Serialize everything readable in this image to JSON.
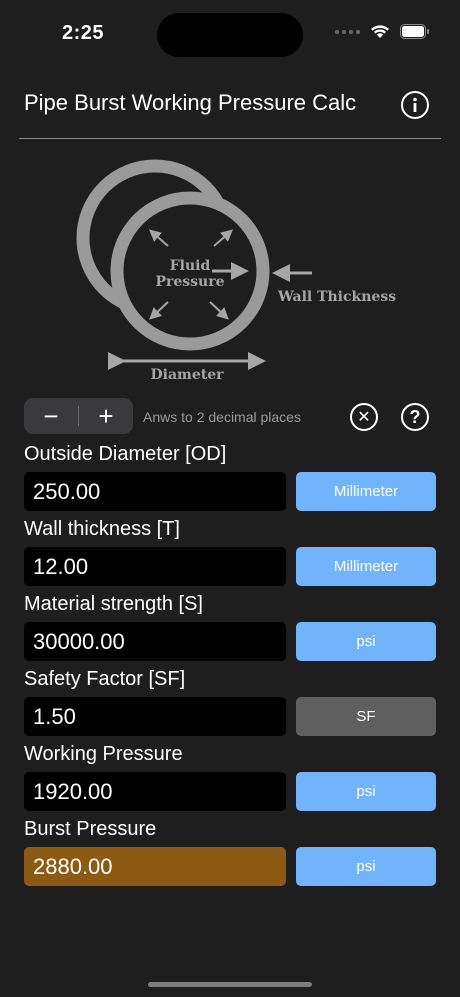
{
  "status_bar": {
    "time": "2:25"
  },
  "header": {
    "title": "Pipe Burst Working Pressure Calc"
  },
  "diagram": {
    "fluid_line1": "Fluid",
    "fluid_line2": "Pressure",
    "wall_label": "Wall Thickness",
    "diameter_label": "Diameter"
  },
  "controls": {
    "minus_label": "−",
    "plus_label": "+",
    "hint": "Anws to 2 decimal places",
    "clear_label": "✕",
    "help_label": "?"
  },
  "fields": [
    {
      "label": "Outside Diameter [OD]",
      "value": "250.00",
      "unit": "Millimeter"
    },
    {
      "label": "Wall thickness [T]",
      "value": "12.00",
      "unit": "Millimeter"
    },
    {
      "label": "Material strength [S]",
      "value": "30000.00",
      "unit": "psi"
    },
    {
      "label": "Safety Factor [SF]",
      "value": "1.50",
      "unit": "SF"
    },
    {
      "label": "Working Pressure",
      "value": "1920.00",
      "unit": "psi"
    },
    {
      "label": "Burst Pressure",
      "value": "2880.00",
      "unit": "psi"
    }
  ],
  "colors": {
    "background": "#1e1e1e",
    "unit_button": "#72b4fb",
    "unit_button_disabled": "#5f5f5f",
    "burst_highlight": "#8c5a12"
  }
}
